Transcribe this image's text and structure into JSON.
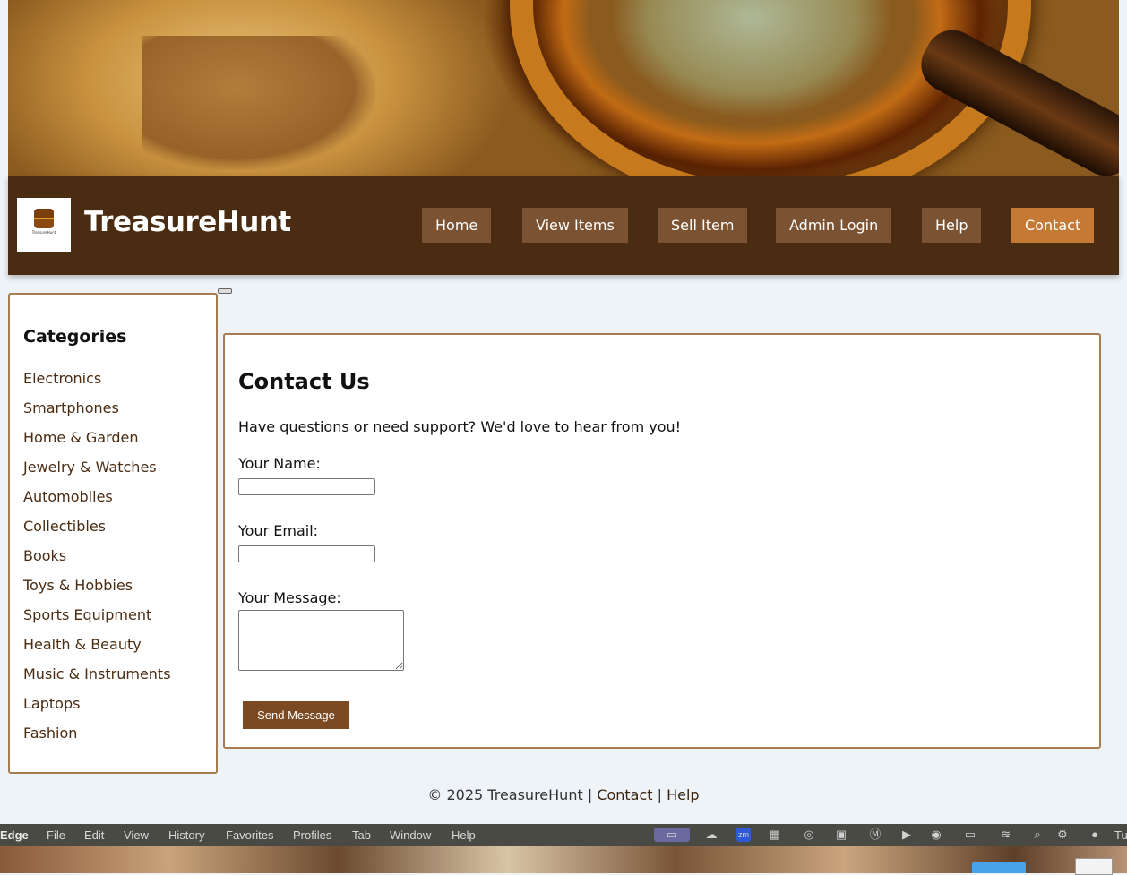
{
  "site": {
    "brand": "TreasureHunt",
    "logo_text": "TreasureHunt"
  },
  "nav": {
    "items": [
      {
        "label": "Home"
      },
      {
        "label": "View Items"
      },
      {
        "label": "Sell Item"
      },
      {
        "label": "Admin Login"
      },
      {
        "label": "Help"
      },
      {
        "label": "Contact",
        "active": true
      }
    ]
  },
  "sidebar": {
    "title": "Categories",
    "categories": [
      "Electronics",
      "Smartphones",
      "Home & Garden",
      "Jewelry & Watches",
      "Automobiles",
      "Collectibles",
      "Books",
      "Toys & Hobbies",
      "Sports Equipment",
      "Health & Beauty",
      "Music & Instruments",
      "Laptops",
      "Fashion"
    ]
  },
  "contact": {
    "title": "Contact Us",
    "intro": "Have questions or need support? We'd love to hear from you!",
    "name_label": "Your Name:",
    "name_value": "",
    "email_label": "Your Email:",
    "email_value": "",
    "message_label": "Your Message:",
    "message_value": "",
    "send_label": "Send Message"
  },
  "footer": {
    "copyright": "© 2025 TreasureHunt | ",
    "contact_link": "Contact",
    "separator": " | ",
    "help_link": "Help"
  },
  "menubar": {
    "app": "Edge",
    "items": [
      "File",
      "Edit",
      "View",
      "History",
      "Favorites",
      "Profiles",
      "Tab",
      "Window",
      "Help"
    ],
    "clock_fragment": "Tu"
  },
  "colors": {
    "header_bg": "#4a2c12",
    "nav_button": "#7b5333",
    "nav_active": "#c47a35",
    "border": "#a67b4e",
    "send_button": "#7b4a22",
    "page_bg": "#eef3f8"
  }
}
